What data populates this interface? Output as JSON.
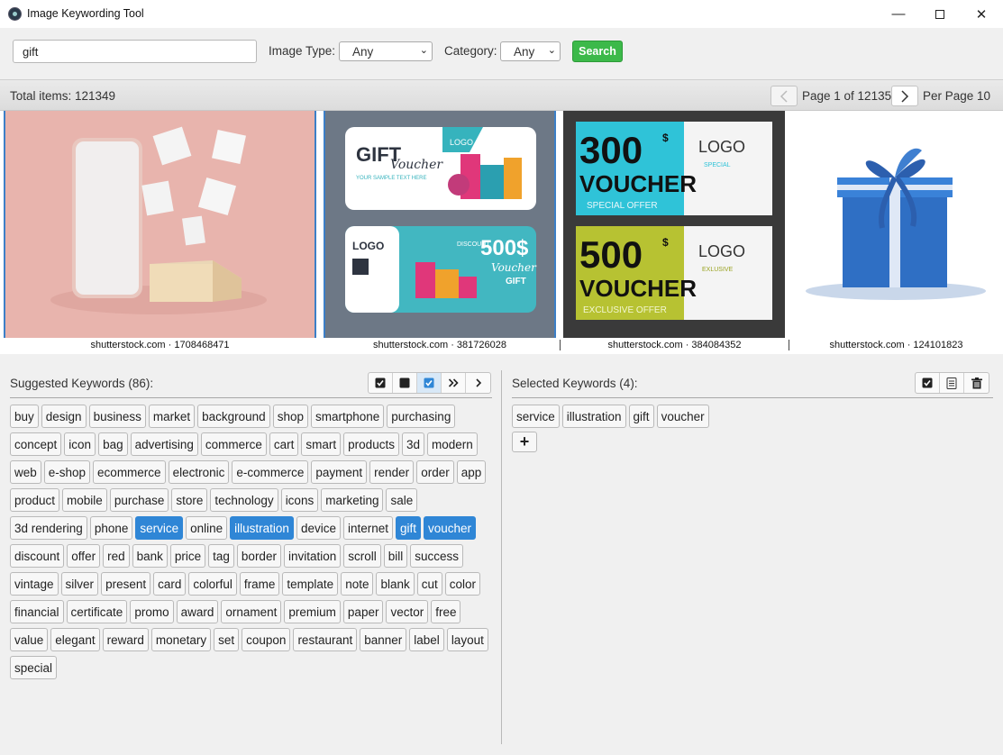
{
  "window": {
    "title": "Image Keywording Tool"
  },
  "toolbar": {
    "search_value": "gift",
    "image_type_label": "Image Type:",
    "image_type_value": "Any",
    "category_label": "Category:",
    "category_value": "Any",
    "search_button": "Search"
  },
  "status": {
    "total_items": "Total items: 121349",
    "page_text": "Page 1 of 12135",
    "per_page": "Per Page 10"
  },
  "images": [
    {
      "caption": "shutterstock.com · 1708468471",
      "selected": true
    },
    {
      "caption": "shutterstock.com · 381726028",
      "selected": true
    },
    {
      "caption": "shutterstock.com · 384084352",
      "selected": false
    },
    {
      "caption": "shutterstock.com · 124101823",
      "selected": false
    }
  ],
  "voucher_art": {
    "gift_title": "GIFT",
    "gift_script": "Voucher",
    "logo": "LOGO",
    "sample_text": "YOUR SAMPLE TEXT HERE",
    "discount": "DISCOUNT",
    "amount_500": "500$",
    "script_voucher": "Voucher",
    "gift_word": "GIFT",
    "v300": "300",
    "v500": "500",
    "currency": "$",
    "voucher_word": "VOUCHER",
    "special_offer": "SPECIAL OFFER",
    "exclusive_offer": "EXCLUSIVE OFFER",
    "special": "SPECIAL",
    "exclusive": "EXLUSIVE"
  },
  "suggested": {
    "title": "Suggested Keywords (86):",
    "keywords": [
      {
        "text": "buy"
      },
      {
        "text": "design"
      },
      {
        "text": "business"
      },
      {
        "text": "market"
      },
      {
        "text": "background"
      },
      {
        "text": "shop"
      },
      {
        "text": "smartphone"
      },
      {
        "text": "purchasing"
      },
      {
        "text": "concept"
      },
      {
        "text": "icon"
      },
      {
        "text": "bag"
      },
      {
        "text": "advertising"
      },
      {
        "text": "commerce"
      },
      {
        "text": "cart"
      },
      {
        "text": "smart"
      },
      {
        "text": "products"
      },
      {
        "text": "3d"
      },
      {
        "text": "modern"
      },
      {
        "text": "web"
      },
      {
        "text": "e-shop"
      },
      {
        "text": "ecommerce"
      },
      {
        "text": "electronic"
      },
      {
        "text": "e-commerce"
      },
      {
        "text": "payment"
      },
      {
        "text": "render"
      },
      {
        "text": "order"
      },
      {
        "text": "app"
      },
      {
        "text": "product"
      },
      {
        "text": "mobile"
      },
      {
        "text": "purchase"
      },
      {
        "text": "store"
      },
      {
        "text": "technology"
      },
      {
        "text": "icons"
      },
      {
        "text": "marketing"
      },
      {
        "text": "sale"
      },
      {
        "text": "3d rendering"
      },
      {
        "text": "phone"
      },
      {
        "text": "service",
        "selected": true
      },
      {
        "text": "online"
      },
      {
        "text": "illustration",
        "selected": true
      },
      {
        "text": "device"
      },
      {
        "text": "internet"
      },
      {
        "text": "gift",
        "selected": true
      },
      {
        "text": "voucher",
        "selected": true
      },
      {
        "text": "discount"
      },
      {
        "text": "offer"
      },
      {
        "text": "red"
      },
      {
        "text": "bank"
      },
      {
        "text": "price"
      },
      {
        "text": "tag"
      },
      {
        "text": "border"
      },
      {
        "text": "invitation"
      },
      {
        "text": "scroll"
      },
      {
        "text": "bill"
      },
      {
        "text": "success"
      },
      {
        "text": "vintage"
      },
      {
        "text": "silver"
      },
      {
        "text": "present"
      },
      {
        "text": "card"
      },
      {
        "text": "colorful"
      },
      {
        "text": "frame"
      },
      {
        "text": "template"
      },
      {
        "text": "note"
      },
      {
        "text": "blank"
      },
      {
        "text": "cut"
      },
      {
        "text": "color"
      },
      {
        "text": "financial"
      },
      {
        "text": "certificate"
      },
      {
        "text": "promo"
      },
      {
        "text": "award"
      },
      {
        "text": "ornament"
      },
      {
        "text": "premium"
      },
      {
        "text": "paper"
      },
      {
        "text": "vector"
      },
      {
        "text": "free"
      },
      {
        "text": "value"
      },
      {
        "text": "elegant"
      },
      {
        "text": "reward"
      },
      {
        "text": "monetary"
      },
      {
        "text": "set"
      },
      {
        "text": "coupon"
      },
      {
        "text": "restaurant"
      },
      {
        "text": "banner"
      },
      {
        "text": "label"
      },
      {
        "text": "layout"
      },
      {
        "text": "special"
      }
    ]
  },
  "selected_keywords": {
    "title": "Selected Keywords (4):",
    "keywords": [
      "service",
      "illustration",
      "gift",
      "voucher"
    ]
  },
  "colors": {
    "accent": "#2f86d6",
    "search_green": "#3cb94a",
    "selection_border": "#3c7fc7"
  }
}
